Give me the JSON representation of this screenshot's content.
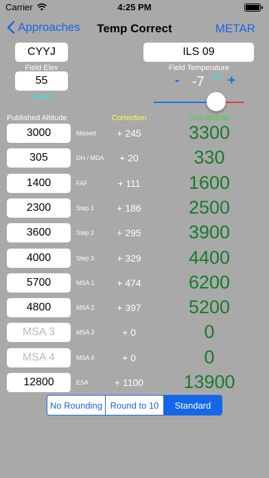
{
  "status": {
    "carrier": "Carrier",
    "time": "4:25 PM"
  },
  "nav": {
    "back_label": "Approaches",
    "title": "Temp Correct",
    "right_label": "METAR"
  },
  "airport": "CYYJ",
  "approach": "ILS 09",
  "field_elev": {
    "label": "Field Elev",
    "value": "55",
    "unit": "(Feet)"
  },
  "field_temp": {
    "label": "Field Temperature",
    "unit": "(C)",
    "value": "-7",
    "minus": "-",
    "plus": "+",
    "slider_fraction": 0.69
  },
  "headers": {
    "published": "Published Altitude",
    "correction": "Correction",
    "true_alt": "True Altitude"
  },
  "rows": [
    {
      "value": "3000",
      "placeholder": false,
      "label": "Missed",
      "correction": "+ 245",
      "true_alt": "3300"
    },
    {
      "value": "305",
      "placeholder": false,
      "label": "DH / MDA",
      "correction": "+ 20",
      "true_alt": "330"
    },
    {
      "value": "1400",
      "placeholder": false,
      "label": "FAF",
      "correction": "+ 111",
      "true_alt": "1600"
    },
    {
      "value": "2300",
      "placeholder": false,
      "label": "Step 1",
      "correction": "+ 186",
      "true_alt": "2500"
    },
    {
      "value": "3600",
      "placeholder": false,
      "label": "Step 2",
      "correction": "+ 295",
      "true_alt": "3900"
    },
    {
      "value": "4000",
      "placeholder": false,
      "label": "Step 3",
      "correction": "+ 329",
      "true_alt": "4400"
    },
    {
      "value": "5700",
      "placeholder": false,
      "label": "MSA 1",
      "correction": "+ 474",
      "true_alt": "6200"
    },
    {
      "value": "4800",
      "placeholder": false,
      "label": "MSA 2",
      "correction": "+ 397",
      "true_alt": "5200"
    },
    {
      "value": "MSA 3",
      "placeholder": true,
      "label": "MSA 3",
      "correction": "+ 0",
      "true_alt": "0"
    },
    {
      "value": "MSA 4",
      "placeholder": true,
      "label": "MSA 4",
      "correction": "+ 0",
      "true_alt": "0"
    },
    {
      "value": "12800",
      "placeholder": false,
      "label": "ESA",
      "correction": "+ 1100",
      "true_alt": "13900"
    }
  ],
  "rounding": {
    "options": [
      "No Rounding",
      "Round to 10",
      "Standard"
    ],
    "selected": "Standard"
  },
  "colors": {
    "background": "#a9a9a9",
    "accent": "#1467e6",
    "true_alt": "#187b2b",
    "correction_header": "#ffff3b",
    "true_header": "#3cd63c",
    "unit": "#29e8e8"
  }
}
